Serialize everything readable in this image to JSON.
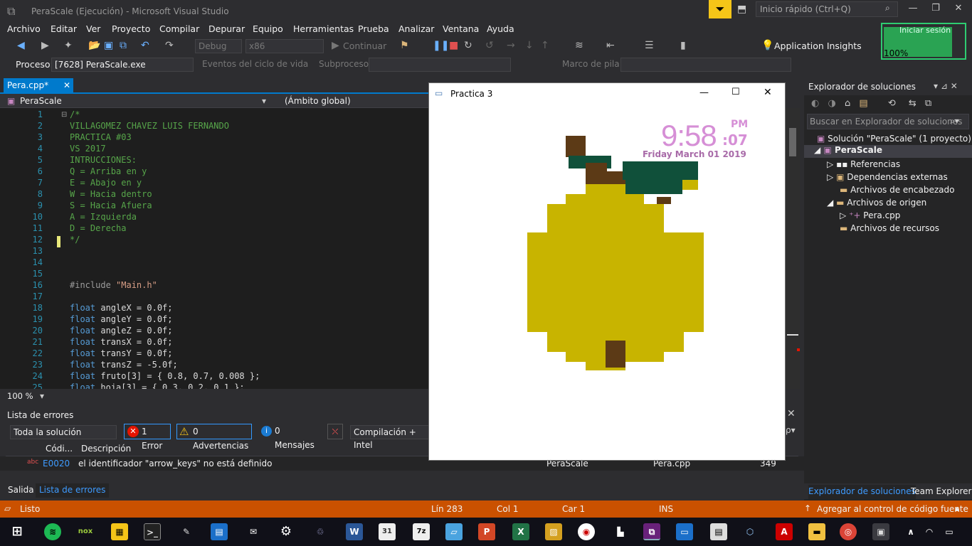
{
  "window": {
    "title": "PeraScale (Ejecución) - Microsoft Visual Studio",
    "quick_launch_placeholder": "Inicio rápido (Ctrl+Q)"
  },
  "menu": [
    "Archivo",
    "Editar",
    "Ver",
    "Proyecto",
    "Compilar",
    "Depurar",
    "Equipo",
    "Herramientas",
    "Prueba",
    "Analizar",
    "Ventana",
    "Ayuda"
  ],
  "toolbar": {
    "config": "Debug",
    "platform": "x86",
    "continue": "Continuar",
    "app_insights": "Application Insights"
  },
  "user": {
    "signin": "Iniciar sesión",
    "percent": "100%"
  },
  "process": {
    "label": "Proceso:",
    "value": "[7628] PeraScale.exe",
    "lifecycle": "Eventos del ciclo de vida",
    "thread": "Subproceso:",
    "stackframe": "Marco de pila:"
  },
  "editor": {
    "tab": "Pera.cpp*",
    "nav_scope": "PeraScale",
    "nav_global": "(Ámbito global)",
    "zoom": "100 %",
    "lines": [
      {
        "n": "1",
        "t": "/*",
        "c": "c-com"
      },
      {
        "n": "2",
        "t": "VILLAGOMEZ CHAVEZ LUIS FERNANDO",
        "c": "c-com"
      },
      {
        "n": "3",
        "t": "PRACTICA #03",
        "c": "c-com"
      },
      {
        "n": "4",
        "t": "VS 2017",
        "c": "c-com"
      },
      {
        "n": "5",
        "t": "INTRUCCIONES:",
        "c": "c-com"
      },
      {
        "n": "6",
        "t": "Q = Arriba en y",
        "c": "c-com"
      },
      {
        "n": "7",
        "t": "E = Abajo en y",
        "c": "c-com"
      },
      {
        "n": "8",
        "t": "W = Hacia dentro",
        "c": "c-com"
      },
      {
        "n": "9",
        "t": "S = Hacia Afuera",
        "c": "c-com"
      },
      {
        "n": "10",
        "t": "A = Izquierda",
        "c": "c-com"
      },
      {
        "n": "11",
        "t": "D = Derecha",
        "c": "c-com"
      },
      {
        "n": "12",
        "t": "*/",
        "c": "c-com"
      },
      {
        "n": "13",
        "t": "",
        "c": "c-tx"
      },
      {
        "n": "14",
        "t": "",
        "c": "c-tx"
      },
      {
        "n": "15",
        "t": "",
        "c": "c-tx"
      },
      {
        "n": "16",
        "t": "#include \"Main.h\"",
        "c": "c-pp"
      },
      {
        "n": "17",
        "t": "",
        "c": "c-tx"
      },
      {
        "n": "18",
        "t": "float angleX = 0.0f;",
        "c": "c-tx"
      },
      {
        "n": "19",
        "t": "float angleY = 0.0f;",
        "c": "c-tx"
      },
      {
        "n": "20",
        "t": "float angleZ = 0.0f;",
        "c": "c-tx"
      },
      {
        "n": "21",
        "t": "float transX = 0.0f;",
        "c": "c-tx"
      },
      {
        "n": "22",
        "t": "float transY = 0.0f;",
        "c": "c-tx"
      },
      {
        "n": "23",
        "t": "float transZ = -5.0f;",
        "c": "c-tx"
      },
      {
        "n": "24",
        "t": "float fruto[3] = { 0.8, 0.7, 0.008 };",
        "c": "c-tx"
      },
      {
        "n": "25",
        "t": "float hoja[3] = { 0.3, 0.2, 0.1 };",
        "c": "c-tx"
      }
    ]
  },
  "errors": {
    "title": "Lista de errores",
    "scope": "Toda la solución",
    "errors_btn": "1 Error",
    "warnings_btn": "0 Advertencias",
    "messages_btn": "0 Mensajes",
    "build_filter": "Compilación + Intel",
    "col_code": "Códi...",
    "col_desc": "Descripción",
    "row": {
      "code": "E0020",
      "desc": "el identificador \"arrow_keys\" no está definido",
      "project": "PeraScale",
      "file": "Pera.cpp",
      "line": "349"
    }
  },
  "bottom_tabs": [
    "Salida",
    "Lista de errores"
  ],
  "solution": {
    "title": "Explorador de soluciones",
    "search": "Buscar en Explorador de soluciones",
    "tree": [
      "Solución \"PeraScale\" (1 proyecto)",
      "PeraScale",
      "Referencias",
      "Dependencias externas",
      "Archivos de encabezado",
      "Archivos de origen",
      "Pera.cpp",
      "Archivos de recursos"
    ],
    "tabs": [
      "Explorador de soluciones",
      "Team Explorer"
    ]
  },
  "status": {
    "ready": "Listo",
    "line": "Lín 283",
    "col": "Col 1",
    "car": "Car 1",
    "ins": "INS",
    "source": "Agregar al control de código fuente"
  },
  "app": {
    "title": "Practica 3",
    "clock_time": "9:58",
    "clock_ampm": "PM",
    "clock_sec": ":07",
    "clock_date": "Friday March 01 2019"
  },
  "colors": {
    "accent": "#007acc",
    "status": "#ca5100",
    "fruit": "#c8b400",
    "leaf": "#10503a",
    "stem": "#5c3a16"
  }
}
